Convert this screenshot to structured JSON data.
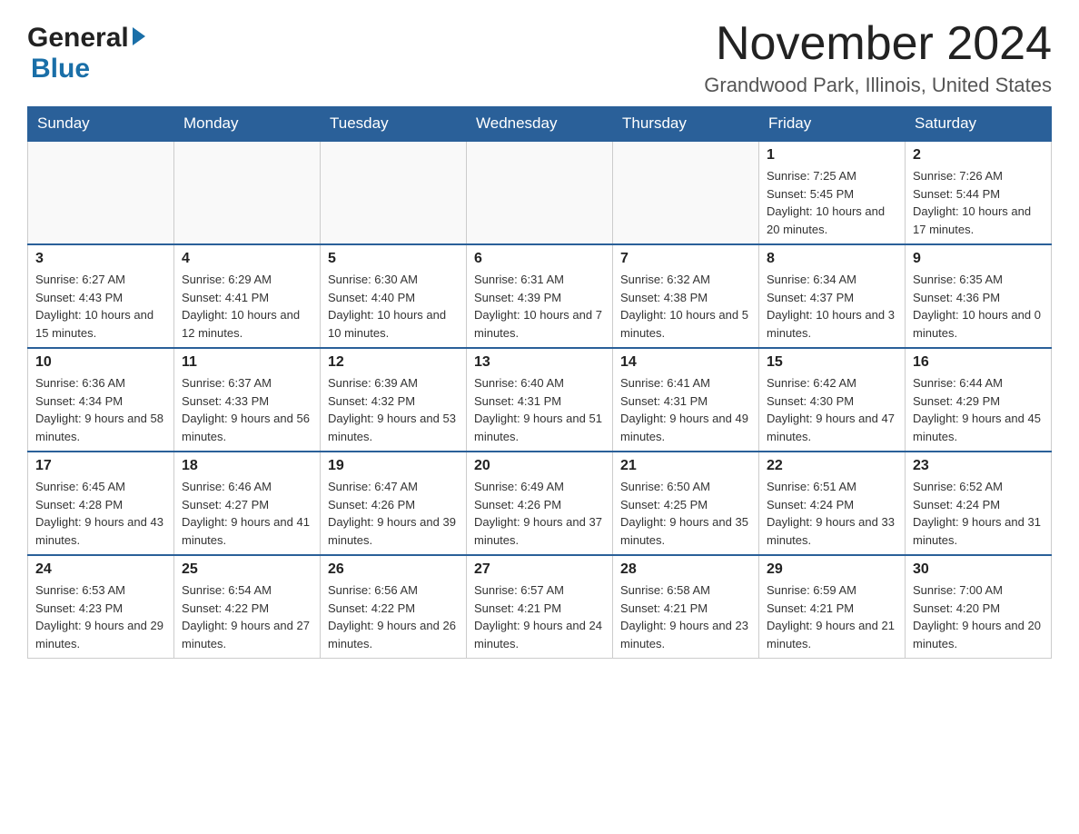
{
  "header": {
    "logo_general": "General",
    "logo_blue": "Blue",
    "month_title": "November 2024",
    "location": "Grandwood Park, Illinois, United States"
  },
  "weekdays": [
    "Sunday",
    "Monday",
    "Tuesday",
    "Wednesday",
    "Thursday",
    "Friday",
    "Saturday"
  ],
  "weeks": [
    [
      {
        "day": "",
        "info": ""
      },
      {
        "day": "",
        "info": ""
      },
      {
        "day": "",
        "info": ""
      },
      {
        "day": "",
        "info": ""
      },
      {
        "day": "",
        "info": ""
      },
      {
        "day": "1",
        "info": "Sunrise: 7:25 AM\nSunset: 5:45 PM\nDaylight: 10 hours and 20 minutes."
      },
      {
        "day": "2",
        "info": "Sunrise: 7:26 AM\nSunset: 5:44 PM\nDaylight: 10 hours and 17 minutes."
      }
    ],
    [
      {
        "day": "3",
        "info": "Sunrise: 6:27 AM\nSunset: 4:43 PM\nDaylight: 10 hours and 15 minutes."
      },
      {
        "day": "4",
        "info": "Sunrise: 6:29 AM\nSunset: 4:41 PM\nDaylight: 10 hours and 12 minutes."
      },
      {
        "day": "5",
        "info": "Sunrise: 6:30 AM\nSunset: 4:40 PM\nDaylight: 10 hours and 10 minutes."
      },
      {
        "day": "6",
        "info": "Sunrise: 6:31 AM\nSunset: 4:39 PM\nDaylight: 10 hours and 7 minutes."
      },
      {
        "day": "7",
        "info": "Sunrise: 6:32 AM\nSunset: 4:38 PM\nDaylight: 10 hours and 5 minutes."
      },
      {
        "day": "8",
        "info": "Sunrise: 6:34 AM\nSunset: 4:37 PM\nDaylight: 10 hours and 3 minutes."
      },
      {
        "day": "9",
        "info": "Sunrise: 6:35 AM\nSunset: 4:36 PM\nDaylight: 10 hours and 0 minutes."
      }
    ],
    [
      {
        "day": "10",
        "info": "Sunrise: 6:36 AM\nSunset: 4:34 PM\nDaylight: 9 hours and 58 minutes."
      },
      {
        "day": "11",
        "info": "Sunrise: 6:37 AM\nSunset: 4:33 PM\nDaylight: 9 hours and 56 minutes."
      },
      {
        "day": "12",
        "info": "Sunrise: 6:39 AM\nSunset: 4:32 PM\nDaylight: 9 hours and 53 minutes."
      },
      {
        "day": "13",
        "info": "Sunrise: 6:40 AM\nSunset: 4:31 PM\nDaylight: 9 hours and 51 minutes."
      },
      {
        "day": "14",
        "info": "Sunrise: 6:41 AM\nSunset: 4:31 PM\nDaylight: 9 hours and 49 minutes."
      },
      {
        "day": "15",
        "info": "Sunrise: 6:42 AM\nSunset: 4:30 PM\nDaylight: 9 hours and 47 minutes."
      },
      {
        "day": "16",
        "info": "Sunrise: 6:44 AM\nSunset: 4:29 PM\nDaylight: 9 hours and 45 minutes."
      }
    ],
    [
      {
        "day": "17",
        "info": "Sunrise: 6:45 AM\nSunset: 4:28 PM\nDaylight: 9 hours and 43 minutes."
      },
      {
        "day": "18",
        "info": "Sunrise: 6:46 AM\nSunset: 4:27 PM\nDaylight: 9 hours and 41 minutes."
      },
      {
        "day": "19",
        "info": "Sunrise: 6:47 AM\nSunset: 4:26 PM\nDaylight: 9 hours and 39 minutes."
      },
      {
        "day": "20",
        "info": "Sunrise: 6:49 AM\nSunset: 4:26 PM\nDaylight: 9 hours and 37 minutes."
      },
      {
        "day": "21",
        "info": "Sunrise: 6:50 AM\nSunset: 4:25 PM\nDaylight: 9 hours and 35 minutes."
      },
      {
        "day": "22",
        "info": "Sunrise: 6:51 AM\nSunset: 4:24 PM\nDaylight: 9 hours and 33 minutes."
      },
      {
        "day": "23",
        "info": "Sunrise: 6:52 AM\nSunset: 4:24 PM\nDaylight: 9 hours and 31 minutes."
      }
    ],
    [
      {
        "day": "24",
        "info": "Sunrise: 6:53 AM\nSunset: 4:23 PM\nDaylight: 9 hours and 29 minutes."
      },
      {
        "day": "25",
        "info": "Sunrise: 6:54 AM\nSunset: 4:22 PM\nDaylight: 9 hours and 27 minutes."
      },
      {
        "day": "26",
        "info": "Sunrise: 6:56 AM\nSunset: 4:22 PM\nDaylight: 9 hours and 26 minutes."
      },
      {
        "day": "27",
        "info": "Sunrise: 6:57 AM\nSunset: 4:21 PM\nDaylight: 9 hours and 24 minutes."
      },
      {
        "day": "28",
        "info": "Sunrise: 6:58 AM\nSunset: 4:21 PM\nDaylight: 9 hours and 23 minutes."
      },
      {
        "day": "29",
        "info": "Sunrise: 6:59 AM\nSunset: 4:21 PM\nDaylight: 9 hours and 21 minutes."
      },
      {
        "day": "30",
        "info": "Sunrise: 7:00 AM\nSunset: 4:20 PM\nDaylight: 9 hours and 20 minutes."
      }
    ]
  ]
}
